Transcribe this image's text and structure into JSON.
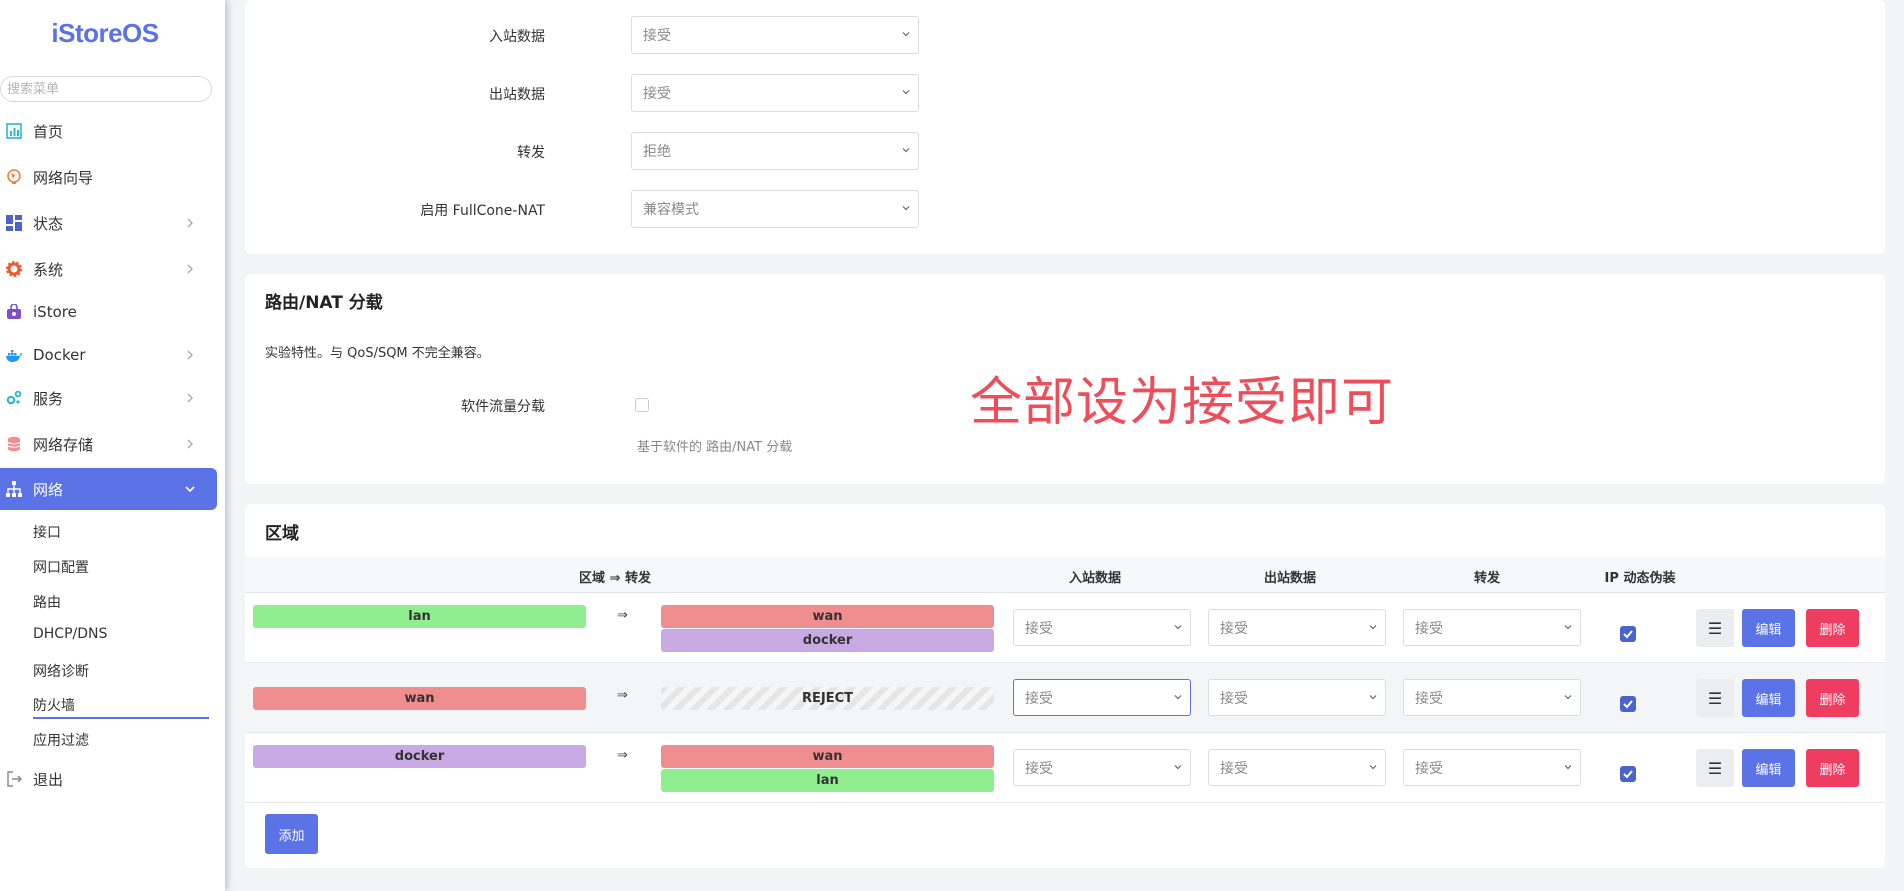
{
  "app": {
    "logo": "iStoreOS",
    "search_placeholder": "搜索菜单"
  },
  "sidebar": {
    "items": [
      {
        "label": "首页",
        "icon": "dashboard-icon",
        "color": "#29b6d8"
      },
      {
        "label": "网络向导",
        "icon": "globe-icon",
        "color": "#f07f3a"
      },
      {
        "label": "状态",
        "icon": "grid-icon",
        "color": "#4a64c9",
        "chevron": true
      },
      {
        "label": "系统",
        "icon": "gear-icon",
        "color": "#ee5a2a",
        "chevron": true
      },
      {
        "label": "iStore",
        "icon": "store-icon",
        "color": "#7952c9"
      },
      {
        "label": "Docker",
        "icon": "docker-icon",
        "color": "#2496ed",
        "chevron": true
      },
      {
        "label": "服务",
        "icon": "cogs-icon",
        "color": "#2bb3d8",
        "chevron": true
      },
      {
        "label": "网络存储",
        "icon": "database-icon",
        "color": "#f08d8f",
        "chevron": true
      },
      {
        "label": "网络",
        "icon": "sitemap-icon",
        "color": "#ffffff",
        "chevron": true,
        "active": true
      }
    ],
    "sub_items": [
      "接口",
      "网口配置",
      "路由",
      "DHCP/DNS",
      "网络诊断",
      "防火墙",
      "应用过滤"
    ],
    "logout": "退出"
  },
  "general": {
    "fields": [
      {
        "label": "入站数据",
        "value": "接受"
      },
      {
        "label": "出站数据",
        "value": "接受"
      },
      {
        "label": "转发",
        "value": "拒绝"
      },
      {
        "label": "启用 FullCone-NAT",
        "value": "兼容模式"
      }
    ]
  },
  "offload": {
    "title": "路由/NAT 分载",
    "description": "实验特性。与 QoS/SQM 不完全兼容。",
    "software_label": "软件流量分载",
    "software_hint": "基于软件的 路由/NAT 分载"
  },
  "annotation": "全部设为接受即可",
  "zones": {
    "title": "区域",
    "headers": {
      "zone_forward": "区域 ⇒ 转发",
      "input": "入站数据",
      "output": "出站数据",
      "forward": "转发",
      "masq": "IP 动态伪装"
    },
    "arrow": "⇒",
    "rows": [
      {
        "zone": "lan",
        "targets": [
          "wan",
          "docker"
        ],
        "input": "接受",
        "output": "接受",
        "forward": "接受"
      },
      {
        "zone": "wan",
        "targets": [
          "REJECT"
        ],
        "input": "接受",
        "output": "接受",
        "forward": "接受"
      },
      {
        "zone": "docker",
        "targets": [
          "wan",
          "lan"
        ],
        "input": "接受",
        "output": "接受",
        "forward": "接受"
      }
    ],
    "menu_glyph": "☰",
    "edit_label": "编辑",
    "delete_label": "删除",
    "add_label": "添加"
  },
  "colors": {
    "accent": "#5b73e6",
    "danger": "#ef3d61",
    "lan": "#90ee90",
    "wan": "#f08d8f",
    "docker": "#c9a9e3",
    "annotation": "#ee4d5a"
  }
}
